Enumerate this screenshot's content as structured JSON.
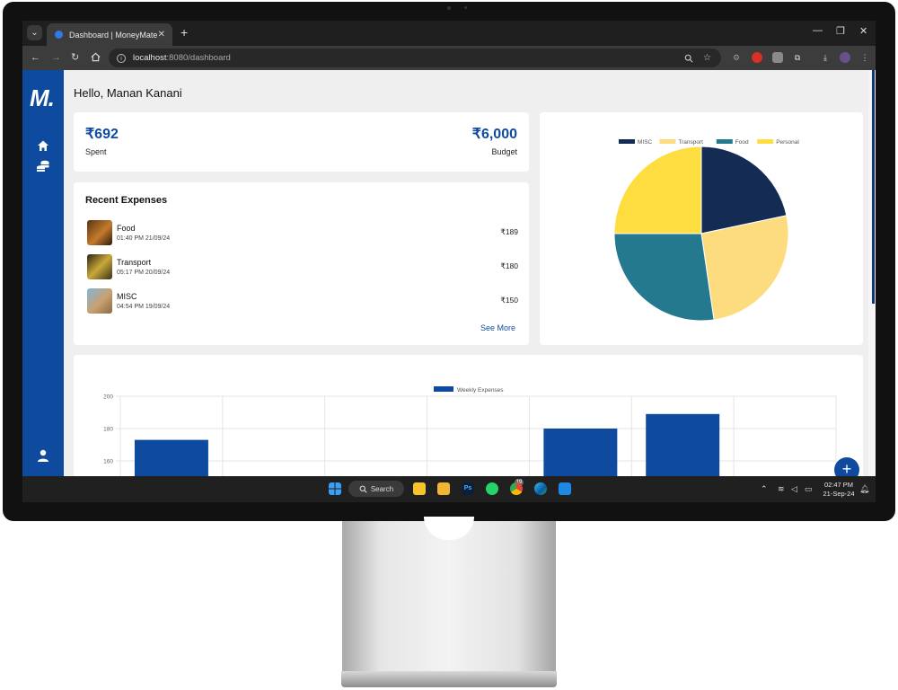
{
  "browser": {
    "tab_title": "Dashboard | MoneyMate",
    "url_host": "localhost",
    "url_rest": ":8080/dashboard",
    "new_tab": "+"
  },
  "app": {
    "logo": "M.",
    "greeting": "Hello, Manan Kanani"
  },
  "summary": {
    "spent_amount": "₹692",
    "spent_label": "Spent",
    "budget_amount": "₹6,000",
    "budget_label": "Budget"
  },
  "recent": {
    "title": "Recent Expenses",
    "items": [
      {
        "name": "Food",
        "time": "01:40 PM 21/09/24",
        "amount": "₹189"
      },
      {
        "name": "Transport",
        "time": "05:17 PM 20/09/24",
        "amount": "₹180"
      },
      {
        "name": "MISC",
        "time": "04:54 PM 19/09/24",
        "amount": "₹150"
      }
    ],
    "see_more": "See More"
  },
  "chart_data": [
    {
      "type": "pie",
      "legend_position": "top",
      "labels": [
        "MISC",
        "Transport",
        "Food",
        "Personal"
      ],
      "values": [
        150,
        180,
        189,
        173
      ],
      "colors": [
        "#142c54",
        "#fddb7f",
        "#24798f",
        "#fddd40"
      ]
    },
    {
      "type": "bar",
      "legend_position": "top",
      "series": [
        {
          "name": "Weekly Expenses",
          "values": [
            173,
            0,
            0,
            0,
            180,
            189,
            0
          ]
        }
      ],
      "color": "#0e4a9e",
      "y_ticks": [
        "200",
        "180",
        "160"
      ],
      "ylim": [
        150,
        200
      ],
      "grid": true
    }
  ],
  "taskbar": {
    "search_label": "Search",
    "whatsapp_badge": "19",
    "clock_time": "02:47 PM",
    "clock_date": "21-Sep-24"
  },
  "colors": {
    "primary": "#0e4a9e"
  }
}
